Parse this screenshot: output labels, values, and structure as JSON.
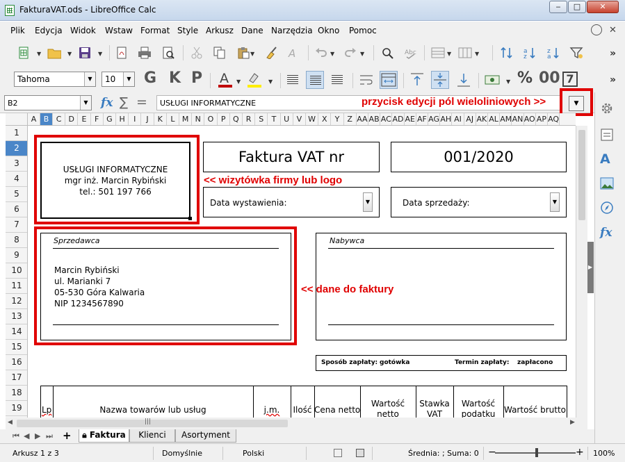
{
  "window": {
    "title": "FakturaVAT.ods - LibreOffice Calc",
    "minimize": "‒",
    "maximize": "□",
    "close": "✕"
  },
  "menu": {
    "items": [
      "Plik",
      "Edycja",
      "Widok",
      "Wstaw",
      "Format",
      "Style",
      "Arkusz",
      "Dane",
      "Narzędzia",
      "Okno",
      "Pomoc"
    ],
    "close_doc": "✕"
  },
  "toolbar2": {
    "font_name": "Tahoma",
    "font_size": "10",
    "bold": "G",
    "italic": "K",
    "underline": "P",
    "percent": "%",
    "decimal": "00",
    "seven": "7"
  },
  "formula_bar": {
    "cell_ref": "B2",
    "content": "USŁUGI INFORMATYCZNE",
    "fx": "fx",
    "sum": "∑",
    "eq": "="
  },
  "annotations": {
    "multiline_edit": "przycisk edycji pól wieloliniowych >>",
    "business_card": "<< wizytówka firmy lub logo",
    "invoice_data": "<< dane do faktury"
  },
  "columns": [
    "A",
    "B",
    "C",
    "D",
    "E",
    "F",
    "G",
    "H",
    "I",
    "J",
    "K",
    "L",
    "M",
    "N",
    "O",
    "P",
    "Q",
    "R",
    "S",
    "T",
    "U",
    "V",
    "W",
    "X",
    "Y",
    "Z",
    "AA",
    "AB",
    "AC",
    "AD",
    "AE",
    "AF",
    "AG",
    "AH",
    "AI",
    "AJ",
    "AK",
    "AL",
    "AM",
    "AN",
    "AO",
    "AP",
    "AQ"
  ],
  "rows": [
    "1",
    "2",
    "3",
    "4",
    "5",
    "6",
    "7",
    "8",
    "9",
    "10",
    "11",
    "12",
    "13",
    "14",
    "15",
    "16",
    "17",
    "18",
    "19"
  ],
  "invoice": {
    "company_line1": "USŁUGI INFORMATYCZNE",
    "company_line2": "mgr inż. Marcin Rybiński",
    "company_line3": "tel.: 501 197 766",
    "title": "Faktura VAT nr",
    "number": "001/2020",
    "issue_date_label": "Data wystawienia:",
    "sale_date_label": "Data sprzedaży:",
    "seller_label": "Sprzedawca",
    "buyer_label": "Nabywca",
    "seller_name": "Marcin Rybiński",
    "seller_street": "ul. Marianki 7",
    "seller_city": "05-530 Góra Kalwaria",
    "seller_nip": "NIP 1234567890",
    "payment_method_label": "Sposób zapłaty:",
    "payment_method": "gotówka",
    "payment_term_label": "Termin zapłaty:",
    "payment_term": "zapłacono",
    "table_headers": {
      "lp": "Lp",
      "name": "Nazwa towarów lub usług",
      "unit": "j.m.",
      "qty": "Ilość",
      "net_price": "Cena netto",
      "net_value_1": "Wartość",
      "net_value_2": "netto",
      "vat_rate_1": "Stawka",
      "vat_rate_2": "VAT",
      "vat_value_1": "Wartość",
      "vat_value_2": "podatku",
      "gross_value": "Wartość brutto"
    }
  },
  "sheet_tabs": [
    "Faktura",
    "Klienci",
    "Asortyment"
  ],
  "status": {
    "sheet": "Arkusz 1 z 3",
    "page_style": "Domyślnie",
    "language": "Polski",
    "summary": "Średnia: ; Suma: 0",
    "zoom_minus": "−",
    "zoom_plus": "+",
    "zoom": "100%"
  },
  "colors": {
    "annotation": "#e00000",
    "selection": "#4a86c8"
  }
}
